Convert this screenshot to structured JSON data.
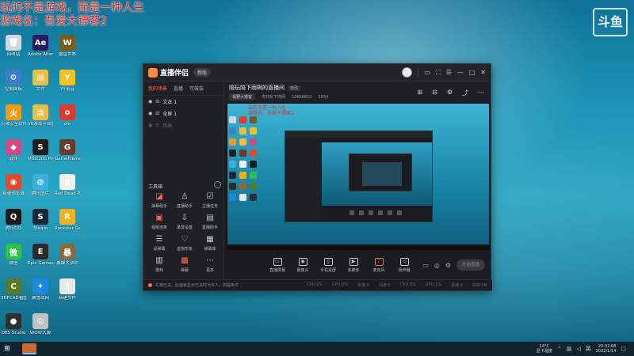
{
  "overlay": {
    "line1": "玩的不是游戏，而是一种人生",
    "line2": "游戏名：吾爱大镖客2"
  },
  "brand_mark": "斗鱼",
  "desktop_icons": [
    {
      "label": "回收站",
      "icon": "recycle-bin-icon",
      "color": "#cfd8dc",
      "glyph": "🗑"
    },
    {
      "label": "Adobe After Effects 2020",
      "icon": "after-effects-icon",
      "color": "#2a1a5e",
      "glyph": "Ae"
    },
    {
      "label": "魔兽世界",
      "icon": "wow-icon",
      "color": "#7a5a1e",
      "glyph": "W"
    },
    {
      "label": "控制面板",
      "icon": "control-panel-icon",
      "color": "#3c7fc8",
      "glyph": "⚙"
    },
    {
      "label": "文件",
      "icon": "folder-icon",
      "color": "#e8c046",
      "glyph": "▤"
    },
    {
      "label": "YY语音",
      "icon": "yy-icon",
      "color": "#f4c21c",
      "glyph": "Y"
    },
    {
      "label": "火绒安全软件",
      "icon": "huorong-icon",
      "color": "#f29b1a",
      "glyph": "火"
    },
    {
      "label": "V6游戏平台图标",
      "icon": "folder-icon",
      "color": "#e8c046",
      "glyph": "▤"
    },
    {
      "label": "ohr",
      "icon": "app-icon",
      "color": "#e03a2e",
      "glyph": "o"
    },
    {
      "label": "软件",
      "icon": "software-icon",
      "color": "#d04a8a",
      "glyph": "◆"
    },
    {
      "label": "MSI2200 Pro Game...",
      "icon": "msi-icon",
      "color": "#1e1e1e",
      "glyph": "S"
    },
    {
      "label": "GameFramet Tha Com...",
      "icon": "game-icon",
      "color": "#6a3a2a",
      "glyph": "G"
    },
    {
      "label": "极速浏览器",
      "icon": "chrome-icon",
      "color": "#e04a2a",
      "glyph": "◉"
    },
    {
      "label": "腾讯图片",
      "icon": "tencent-photo-icon",
      "color": "#3ab0e0",
      "glyph": "◍"
    },
    {
      "label": "Red Dead Redempti...",
      "icon": "file-icon",
      "color": "#f0f0f0",
      "glyph": "▯"
    },
    {
      "label": "腾讯QQ",
      "icon": "qq-icon",
      "color": "#1a1a1a",
      "glyph": "Q"
    },
    {
      "label": "Steam",
      "icon": "steam-icon",
      "color": "#1b2838",
      "glyph": "S"
    },
    {
      "label": "Rockstar Games...",
      "icon": "rockstar-icon",
      "color": "#f2b21c",
      "glyph": "R"
    },
    {
      "label": "微信",
      "icon": "wechat-icon",
      "color": "#2ec24a",
      "glyph": "微"
    },
    {
      "label": "Epic Games Launcher",
      "icon": "epic-icon",
      "color": "#2a2a2a",
      "glyph": "E"
    },
    {
      "label": "暴躁大法师",
      "icon": "game-icon",
      "color": "#8a6a3a",
      "glyph": "暴"
    },
    {
      "label": "3DFCAD看图软件",
      "icon": "cad-icon",
      "color": "#5a7a2a",
      "glyph": "C"
    },
    {
      "label": "暴雪战网",
      "icon": "battlenet-icon",
      "color": "#1a8ae0",
      "glyph": "✦"
    },
    {
      "label": "新建文件",
      "icon": "file-icon",
      "color": "#e8e8e8",
      "glyph": "▯"
    },
    {
      "label": "OBS Studio",
      "icon": "obs-icon",
      "color": "#302e31",
      "glyph": "●"
    },
    {
      "label": "WOW大脚",
      "icon": "wow-bigfoot-icon",
      "color": "#c0c0c0",
      "glyph": "◎"
    }
  ],
  "app": {
    "name": "直播伴侣",
    "version_badge": "新版",
    "left_tabs": [
      "我的场景",
      "直播",
      "可做装"
    ],
    "scenes": [
      {
        "name": "文本 1",
        "dim": false
      },
      {
        "name": "全屏 1",
        "dim": false
      },
      {
        "name": "场景",
        "dim": true
      }
    ],
    "tools_title": "工具箱",
    "tools": [
      {
        "label": "弹幕助手",
        "glyph": "◪",
        "hot": true
      },
      {
        "label": "直播助手",
        "glyph": "♙",
        "hot": false
      },
      {
        "label": "主播任务",
        "glyph": "☑",
        "hot": false
      },
      {
        "label": "视频连麦",
        "glyph": "▣",
        "hot": true
      },
      {
        "label": "录屏设置",
        "glyph": "⇩",
        "hot": false
      },
      {
        "label": "直播助手",
        "glyph": "▤",
        "hot": false
      },
      {
        "label": "设弹幕",
        "glyph": "☰",
        "hot": false
      },
      {
        "label": "虚拟形象",
        "glyph": "♡",
        "hot": false
      },
      {
        "label": "弹幕库",
        "glyph": "▦",
        "hot": false
      },
      {
        "label": "游戏",
        "glyph": "▥",
        "hot": false
      },
      {
        "label": "弹幕",
        "glyph": "▩",
        "hot": true
      },
      {
        "label": "更多",
        "glyph": "⋯",
        "hot": false
      }
    ],
    "room": {
      "title": "陪玩陪下雨啊的直播间",
      "edit_label": "修改",
      "chip": "视野大镖客",
      "meta1": "粤开房下饰网",
      "meta2": "10666810",
      "meta3": "3054"
    },
    "room_tool_icons": [
      "gift-icon",
      "cart-icon",
      "settings-icon",
      "share-icon",
      "more-icon"
    ],
    "preview_text": [
      "玩的不是一种人生",
      "游戏名：吾爱大镖客2"
    ],
    "controls": [
      {
        "label": "直播屏幕",
        "glyph": "▭",
        "mic": false
      },
      {
        "label": "摄像头",
        "glyph": "◉",
        "mic": false
      },
      {
        "label": "手机投屏",
        "glyph": "▯",
        "mic": false
      },
      {
        "label": "多媒体",
        "glyph": "▶",
        "mic": false
      },
      {
        "label": "麦克风",
        "glyph": "♪",
        "mic": true
      },
      {
        "label": "扬声器",
        "glyph": "◁",
        "mic": false
      }
    ],
    "go_live_label": "开始直播",
    "notice_text": "礼物已关，此面板显示已关时允许人，前提条件",
    "stats": [
      "CPU:9%",
      "GPU:0%",
      "帧率:0",
      "码率:0",
      "CPU:5%",
      "GPU:1%",
      "丢帧:0",
      "内存:0M"
    ]
  },
  "taskbar": {
    "weather_temp": "14°C",
    "weather_desc": "显卡温度",
    "time": "20:32:08",
    "date": "2022/1/14"
  }
}
